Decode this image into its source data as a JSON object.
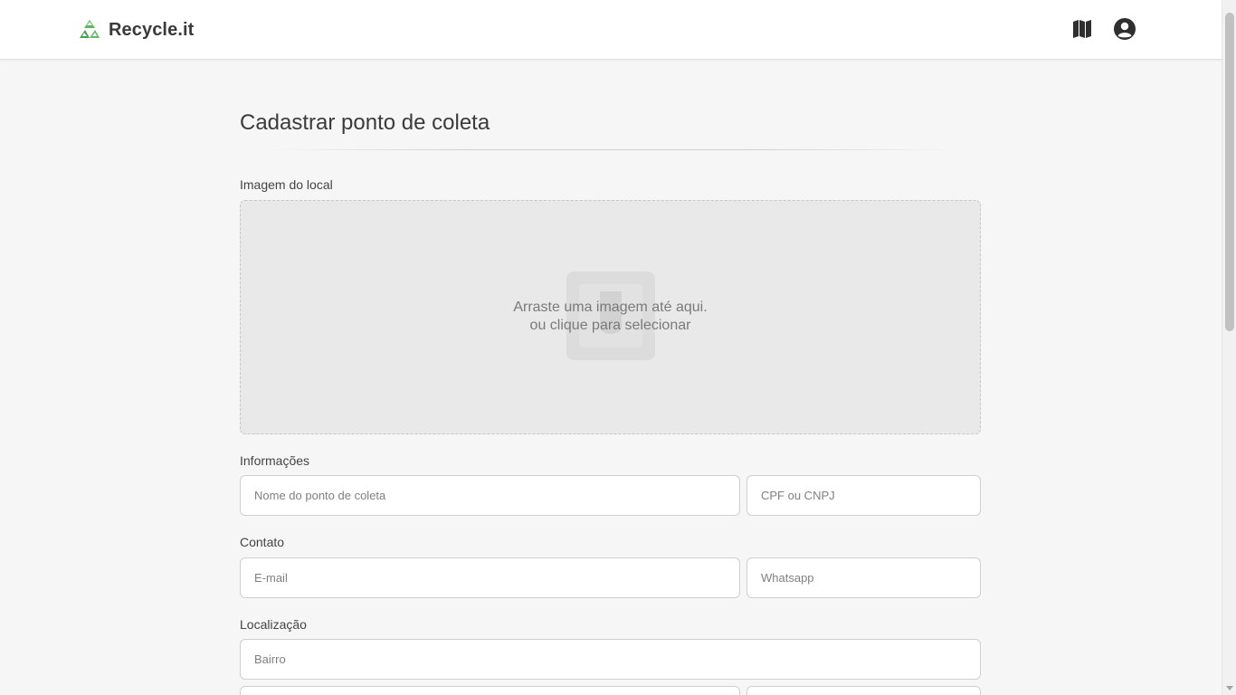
{
  "header": {
    "brand_name": "Recycle.it",
    "logo_icon": "recycle-icon",
    "nav_icons": [
      "map-icon",
      "user-account-icon"
    ],
    "brand_color": "#4caf50"
  },
  "page": {
    "title": "Cadastrar ponto de coleta"
  },
  "image_section": {
    "label": "Imagem do local",
    "drop_line1": "Arraste uma imagem até aqui.",
    "drop_line2": "ou clique para selecionar",
    "icon": "upload-image-icon"
  },
  "info_section": {
    "label": "Informações",
    "name_placeholder": "Nome do ponto de coleta",
    "name_value": "",
    "doc_placeholder": "CPF ou CNPJ",
    "doc_value": ""
  },
  "contact_section": {
    "label": "Contato",
    "email_placeholder": "E-mail",
    "email_value": "",
    "whatsapp_placeholder": "Whatsapp",
    "whatsapp_value": ""
  },
  "location_section": {
    "label": "Localização",
    "neighborhood_placeholder": "Bairro",
    "neighborhood_value": "",
    "street_placeholder": "",
    "number_placeholder": ""
  }
}
